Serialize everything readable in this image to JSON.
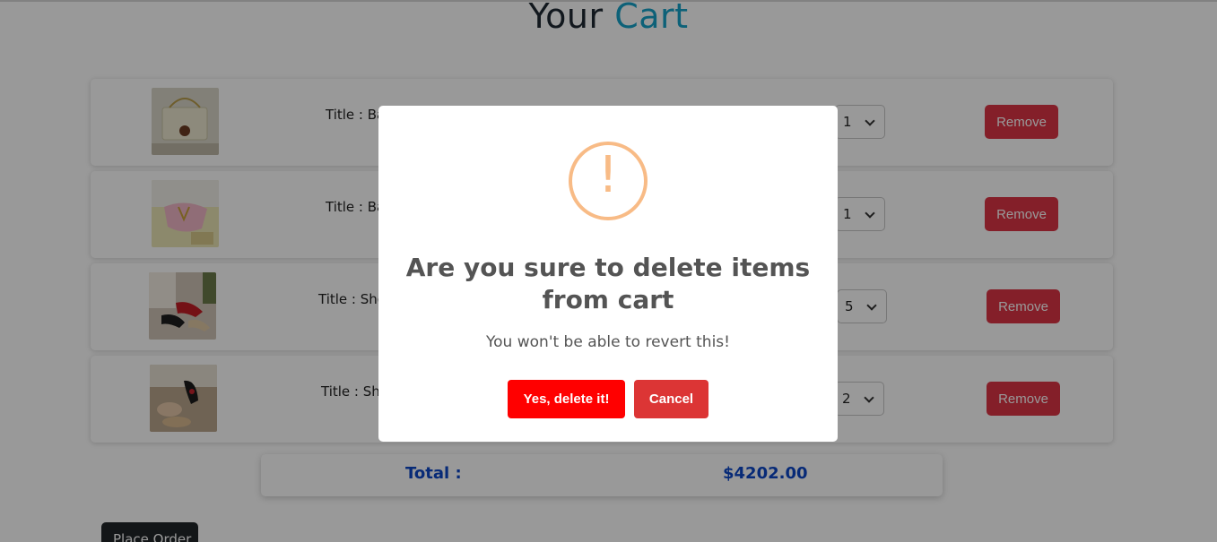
{
  "page": {
    "title_prefix": "Your",
    "title_accent": "Cart"
  },
  "cart": {
    "items": [
      {
        "title": "Title : Ba",
        "quantity": "1",
        "remove_label": "Remove",
        "image": "beige-quilted-handbag"
      },
      {
        "title": "Title : Ba",
        "quantity": "1",
        "remove_label": "Remove",
        "image": "pink-handbag"
      },
      {
        "title": "Title : Sho",
        "quantity": "5",
        "remove_label": "Remove",
        "image": "red-heeled-shoes"
      },
      {
        "title": "Title : Sho",
        "quantity": "2",
        "remove_label": "Remove",
        "image": "sandals"
      }
    ],
    "total_label": "Total :",
    "total_value": "$4202.00",
    "place_order_label": "Place Order"
  },
  "dialog": {
    "icon": "warning-icon",
    "title": "Are you sure to delete items from cart",
    "text": "You won't be able to revert this!",
    "confirm_label": "Yes, delete it!",
    "cancel_label": "Cancel"
  },
  "colors": {
    "accent": "#17a2c9",
    "remove": "#dc3545",
    "confirm": "#ff0000",
    "cancel": "#dc3535",
    "total": "#0d47c7",
    "warning": "#f8bb86"
  }
}
